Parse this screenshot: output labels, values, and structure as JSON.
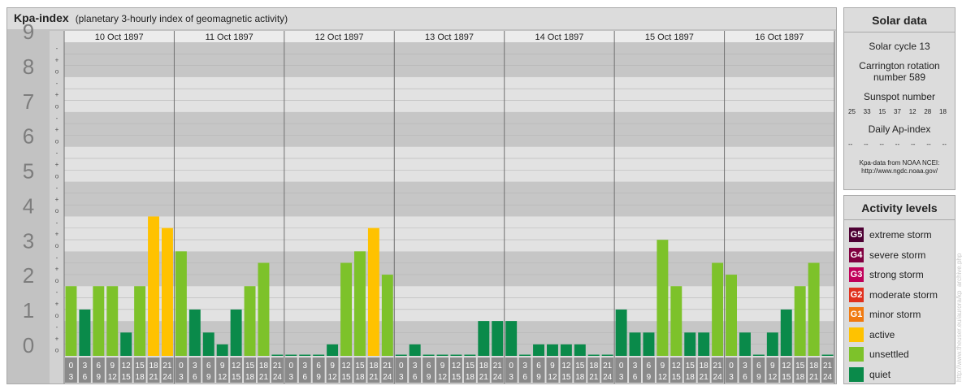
{
  "header": {
    "title": "Kpa-index",
    "subtitle": "(planetary 3-hourly index of geomagnetic activity)"
  },
  "solar": {
    "title": "Solar data",
    "cycle": "Solar cycle 13",
    "carrington_line1": "Carrington rotation",
    "carrington_line2": "number 589",
    "sunspot_label": "Sunspot number",
    "sunspot_values": [
      "25",
      "33",
      "15",
      "37",
      "12",
      "28",
      "18"
    ],
    "ap_label": "Daily Ap-index",
    "ap_values": [
      "--",
      "--",
      "--",
      "--",
      "--",
      "--",
      "--"
    ],
    "credit_line1": "Kpa-data from NOAA NCEI:",
    "credit_line2": "http://www.ngdc.noaa.gov/"
  },
  "levels": {
    "title": "Activity levels",
    "items": [
      {
        "code": "G5",
        "label": "extreme storm",
        "color": "#4d0033"
      },
      {
        "code": "G4",
        "label": "severe storm",
        "color": "#800040"
      },
      {
        "code": "G3",
        "label": "strong storm",
        "color": "#c0005a"
      },
      {
        "code": "G2",
        "label": "moderate storm",
        "color": "#e0301e"
      },
      {
        "code": "G1",
        "label": "minor storm",
        "color": "#f07a10"
      },
      {
        "code": "",
        "label": "active",
        "color": "#ffc200"
      },
      {
        "code": "",
        "label": "unsettled",
        "color": "#7dc22a"
      },
      {
        "code": "",
        "label": "quiet",
        "color": "#0a8a4a"
      }
    ]
  },
  "watermark": "http://www.theuser.eu/aurora/kp_archive.php",
  "chart_data": {
    "type": "bar",
    "title": "Kpa-index",
    "ylim": [
      0,
      9
    ],
    "y_ticks": [
      "0",
      "1",
      "2",
      "3",
      "4",
      "5",
      "6",
      "7",
      "8",
      "9"
    ],
    "minor_marks": [
      "o",
      "+",
      "-"
    ],
    "interval_start_labels": [
      "0",
      "3",
      "6",
      "9",
      "12",
      "15",
      "18",
      "21"
    ],
    "interval_end_labels": [
      "3",
      "6",
      "9",
      "12",
      "15",
      "18",
      "21",
      "24"
    ],
    "colors": {
      "quiet": "#0a8a4a",
      "unsettled": "#7dc22a",
      "active": "#ffc200"
    },
    "days": [
      {
        "date": "10 Oct 1897",
        "values": [
          2.0,
          1.33,
          2.0,
          2.0,
          0.67,
          2.0,
          4.0,
          3.67
        ]
      },
      {
        "date": "11 Oct 1897",
        "values": [
          3.0,
          1.33,
          0.67,
          0.33,
          1.33,
          2.0,
          2.67,
          0.0
        ]
      },
      {
        "date": "12 Oct 1897",
        "values": [
          0.0,
          0.0,
          0.0,
          0.33,
          2.67,
          3.0,
          3.67,
          2.33
        ]
      },
      {
        "date": "13 Oct 1897",
        "values": [
          0.0,
          0.33,
          0.0,
          0.0,
          0.0,
          0.0,
          1.0,
          1.0
        ]
      },
      {
        "date": "14 Oct 1897",
        "values": [
          1.0,
          0.0,
          0.33,
          0.33,
          0.33,
          0.33,
          0.0,
          0.0
        ]
      },
      {
        "date": "15 Oct 1897",
        "values": [
          1.33,
          0.67,
          0.67,
          3.33,
          2.0,
          0.67,
          0.67,
          2.67
        ]
      },
      {
        "date": "16 Oct 1897",
        "values": [
          2.33,
          0.67,
          0.0,
          0.67,
          1.33,
          2.0,
          2.67,
          0.0
        ]
      }
    ]
  }
}
